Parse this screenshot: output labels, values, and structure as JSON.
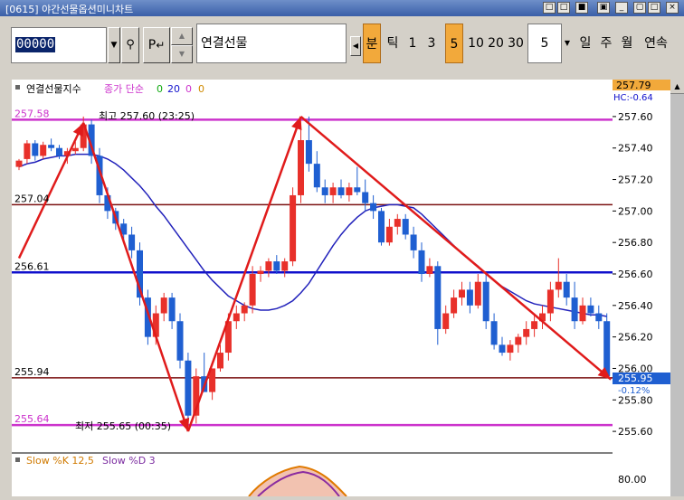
{
  "window": {
    "title": "[0615] 야간선물옵션미니차트"
  },
  "toolbar": {
    "code_value": "00000",
    "p_label": "P",
    "instrument_name": "연결선물",
    "periods": [
      {
        "label": "분",
        "active": true
      },
      {
        "label": "틱",
        "active": false
      },
      {
        "label": "1",
        "active": false
      },
      {
        "label": "3",
        "active": false
      },
      {
        "label": "5",
        "active": true
      },
      {
        "label": "10",
        "active": false
      },
      {
        "label": "20",
        "active": false
      },
      {
        "label": "30",
        "active": false
      }
    ],
    "interval_value": "5",
    "timeframes": [
      "일",
      "주",
      "월",
      "연속"
    ]
  },
  "colors": {
    "up": "#e8302a",
    "down": "#1f5fd1",
    "ma": "#2222bb",
    "highlight_line": "#cc33cc",
    "level_line": "#7a1010",
    "blue_line": "#1010cc",
    "arrow": "#e01b1b"
  },
  "legend": {
    "name": "연결선물지수",
    "mode": "종가 단순",
    "p1": "0",
    "p2": "20",
    "p3": "0",
    "p4": "0"
  },
  "levels": [
    {
      "label": "257.58",
      "value": 257.58,
      "kind": "highlight"
    },
    {
      "label": "257.04",
      "value": 257.04,
      "kind": "level"
    },
    {
      "label": "256.61",
      "value": 256.61,
      "kind": "blue"
    },
    {
      "label": "255.94",
      "value": 255.94,
      "kind": "level"
    },
    {
      "label": "255.64",
      "value": 255.64,
      "kind": "highlight"
    }
  ],
  "annotations": {
    "high": "최고 257.60 (23:25)",
    "low": "최저 255.65 (00:35)"
  },
  "axis": {
    "top_value": "257.79",
    "change_label": "HC:-0.64",
    "current_value": "255.95",
    "current_change": "-0.12%"
  },
  "stochastic": {
    "k_label": "Slow %K 12,5",
    "d_label": "Slow %D 3",
    "tick": "80.00"
  },
  "chart_data": {
    "type": "candlestick",
    "ylim": [
      255.48,
      257.72
    ],
    "y_ticks": [
      "257.60",
      "257.40",
      "257.20",
      "257.00",
      "256.80",
      "256.60",
      "256.40",
      "256.20",
      "256.00",
      "255.80",
      "255.60"
    ],
    "candles": [
      {
        "o": 257.28,
        "h": 257.33,
        "l": 257.26,
        "c": 257.32
      },
      {
        "o": 257.33,
        "h": 257.45,
        "l": 257.3,
        "c": 257.43
      },
      {
        "o": 257.43,
        "h": 257.45,
        "l": 257.32,
        "c": 257.35
      },
      {
        "o": 257.35,
        "h": 257.44,
        "l": 257.33,
        "c": 257.42
      },
      {
        "o": 257.42,
        "h": 257.46,
        "l": 257.38,
        "c": 257.4
      },
      {
        "o": 257.4,
        "h": 257.42,
        "l": 257.33,
        "c": 257.35
      },
      {
        "o": 257.35,
        "h": 257.4,
        "l": 257.3,
        "c": 257.38
      },
      {
        "o": 257.38,
        "h": 257.44,
        "l": 257.36,
        "c": 257.4
      },
      {
        "o": 257.4,
        "h": 257.6,
        "l": 257.38,
        "c": 257.55
      },
      {
        "o": 257.55,
        "h": 257.58,
        "l": 257.3,
        "c": 257.35
      },
      {
        "o": 257.35,
        "h": 257.4,
        "l": 257.05,
        "c": 257.1
      },
      {
        "o": 257.1,
        "h": 257.15,
        "l": 256.95,
        "c": 257.0
      },
      {
        "o": 257.0,
        "h": 257.02,
        "l": 256.88,
        "c": 256.92
      },
      {
        "o": 256.92,
        "h": 256.95,
        "l": 256.8,
        "c": 256.85
      },
      {
        "o": 256.85,
        "h": 256.9,
        "l": 256.7,
        "c": 256.75
      },
      {
        "o": 256.75,
        "h": 256.8,
        "l": 256.4,
        "c": 256.45
      },
      {
        "o": 256.45,
        "h": 256.5,
        "l": 256.15,
        "c": 256.2
      },
      {
        "o": 256.2,
        "h": 256.4,
        "l": 256.15,
        "c": 256.35
      },
      {
        "o": 256.35,
        "h": 256.48,
        "l": 256.3,
        "c": 256.45
      },
      {
        "o": 256.45,
        "h": 256.48,
        "l": 256.25,
        "c": 256.3
      },
      {
        "o": 256.3,
        "h": 256.35,
        "l": 256.0,
        "c": 256.05
      },
      {
        "o": 256.05,
        "h": 256.1,
        "l": 255.64,
        "c": 255.7
      },
      {
        "o": 255.7,
        "h": 256.0,
        "l": 255.65,
        "c": 255.95
      },
      {
        "o": 255.95,
        "h": 256.1,
        "l": 255.9,
        "c": 255.85
      },
      {
        "o": 255.85,
        "h": 256.0,
        "l": 255.8,
        "c": 256.0
      },
      {
        "o": 256.0,
        "h": 256.15,
        "l": 255.98,
        "c": 256.1
      },
      {
        "o": 256.1,
        "h": 256.35,
        "l": 256.05,
        "c": 256.3
      },
      {
        "o": 256.3,
        "h": 256.4,
        "l": 256.25,
        "c": 256.35
      },
      {
        "o": 256.35,
        "h": 256.42,
        "l": 256.3,
        "c": 256.4
      },
      {
        "o": 256.4,
        "h": 256.65,
        "l": 256.35,
        "c": 256.6
      },
      {
        "o": 256.6,
        "h": 256.65,
        "l": 256.55,
        "c": 256.62
      },
      {
        "o": 256.62,
        "h": 256.7,
        "l": 256.58,
        "c": 256.68
      },
      {
        "o": 256.68,
        "h": 256.72,
        "l": 256.6,
        "c": 256.62
      },
      {
        "o": 256.62,
        "h": 256.7,
        "l": 256.58,
        "c": 256.68
      },
      {
        "o": 256.68,
        "h": 257.15,
        "l": 256.65,
        "c": 257.1
      },
      {
        "o": 257.1,
        "h": 257.55,
        "l": 257.05,
        "c": 257.45
      },
      {
        "o": 257.45,
        "h": 257.6,
        "l": 257.25,
        "c": 257.3
      },
      {
        "o": 257.3,
        "h": 257.38,
        "l": 257.12,
        "c": 257.15
      },
      {
        "o": 257.15,
        "h": 257.2,
        "l": 257.05,
        "c": 257.1
      },
      {
        "o": 257.1,
        "h": 257.18,
        "l": 257.05,
        "c": 257.15
      },
      {
        "o": 257.15,
        "h": 257.2,
        "l": 257.08,
        "c": 257.1
      },
      {
        "o": 257.1,
        "h": 257.18,
        "l": 257.06,
        "c": 257.15
      },
      {
        "o": 257.15,
        "h": 257.28,
        "l": 257.1,
        "c": 257.12
      },
      {
        "o": 257.12,
        "h": 257.2,
        "l": 257.0,
        "c": 257.05
      },
      {
        "o": 257.05,
        "h": 257.1,
        "l": 256.95,
        "c": 257.0
      },
      {
        "o": 257.0,
        "h": 257.02,
        "l": 256.78,
        "c": 256.8
      },
      {
        "o": 256.8,
        "h": 256.95,
        "l": 256.78,
        "c": 256.9
      },
      {
        "o": 256.9,
        "h": 256.98,
        "l": 256.85,
        "c": 256.95
      },
      {
        "o": 256.95,
        "h": 256.98,
        "l": 256.82,
        "c": 256.85
      },
      {
        "o": 256.85,
        "h": 256.9,
        "l": 256.7,
        "c": 256.75
      },
      {
        "o": 256.75,
        "h": 256.8,
        "l": 256.55,
        "c": 256.6
      },
      {
        "o": 256.6,
        "h": 256.7,
        "l": 256.58,
        "c": 256.65
      },
      {
        "o": 256.65,
        "h": 256.68,
        "l": 256.15,
        "c": 256.25
      },
      {
        "o": 256.25,
        "h": 256.4,
        "l": 256.22,
        "c": 256.35
      },
      {
        "o": 256.35,
        "h": 256.5,
        "l": 256.32,
        "c": 256.45
      },
      {
        "o": 256.45,
        "h": 256.55,
        "l": 256.4,
        "c": 256.5
      },
      {
        "o": 256.5,
        "h": 256.55,
        "l": 256.35,
        "c": 256.4
      },
      {
        "o": 256.4,
        "h": 256.6,
        "l": 256.38,
        "c": 256.55
      },
      {
        "o": 256.55,
        "h": 256.6,
        "l": 256.25,
        "c": 256.3
      },
      {
        "o": 256.3,
        "h": 256.35,
        "l": 256.12,
        "c": 256.15
      },
      {
        "o": 256.15,
        "h": 256.2,
        "l": 256.08,
        "c": 256.1
      },
      {
        "o": 256.1,
        "h": 256.18,
        "l": 256.05,
        "c": 256.15
      },
      {
        "o": 256.15,
        "h": 256.22,
        "l": 256.1,
        "c": 256.2
      },
      {
        "o": 256.2,
        "h": 256.3,
        "l": 256.15,
        "c": 256.25
      },
      {
        "o": 256.25,
        "h": 256.35,
        "l": 256.2,
        "c": 256.3
      },
      {
        "o": 256.3,
        "h": 256.4,
        "l": 256.25,
        "c": 256.35
      },
      {
        "o": 256.35,
        "h": 256.55,
        "l": 256.3,
        "c": 256.5
      },
      {
        "o": 256.5,
        "h": 256.7,
        "l": 256.45,
        "c": 256.55
      },
      {
        "o": 256.55,
        "h": 256.6,
        "l": 256.4,
        "c": 256.45
      },
      {
        "o": 256.45,
        "h": 256.55,
        "l": 256.25,
        "c": 256.3
      },
      {
        "o": 256.3,
        "h": 256.45,
        "l": 256.28,
        "c": 256.4
      },
      {
        "o": 256.4,
        "h": 256.45,
        "l": 256.33,
        "c": 256.35
      },
      {
        "o": 256.35,
        "h": 256.4,
        "l": 256.25,
        "c": 256.3
      },
      {
        "o": 256.3,
        "h": 256.35,
        "l": 255.95,
        "c": 255.95
      }
    ],
    "moving_average": [
      257.28,
      257.3,
      257.31,
      257.33,
      257.34,
      257.35,
      257.35,
      257.36,
      257.36,
      257.36,
      257.35,
      257.33,
      257.3,
      257.26,
      257.21,
      257.16,
      257.1,
      257.03,
      256.97,
      256.9,
      256.83,
      256.76,
      256.69,
      256.62,
      256.56,
      256.51,
      256.46,
      256.43,
      256.4,
      256.38,
      256.37,
      256.37,
      256.38,
      256.4,
      256.43,
      256.48,
      256.54,
      256.62,
      256.7,
      256.78,
      256.85,
      256.91,
      256.96,
      257.0,
      257.02,
      257.03,
      257.04,
      257.04,
      257.03,
      257.02,
      256.98,
      256.93,
      256.88,
      256.83,
      256.78,
      256.73,
      256.69,
      256.65,
      256.6,
      256.56,
      256.52,
      256.49,
      256.46,
      256.43,
      256.41,
      256.4,
      256.39,
      256.38,
      256.37,
      256.36,
      256.35,
      256.34,
      256.34,
      256.33
    ],
    "trend_arrows": [
      {
        "from": [
          0,
          256.7
        ],
        "to": [
          8,
          257.56
        ]
      },
      {
        "from": [
          8,
          257.56
        ],
        "to": [
          21,
          255.6
        ]
      },
      {
        "from": [
          21,
          255.6
        ],
        "to": [
          35,
          257.6
        ]
      },
      {
        "from": [
          35,
          257.6
        ],
        "to": [
          73.5,
          255.93
        ]
      }
    ]
  }
}
